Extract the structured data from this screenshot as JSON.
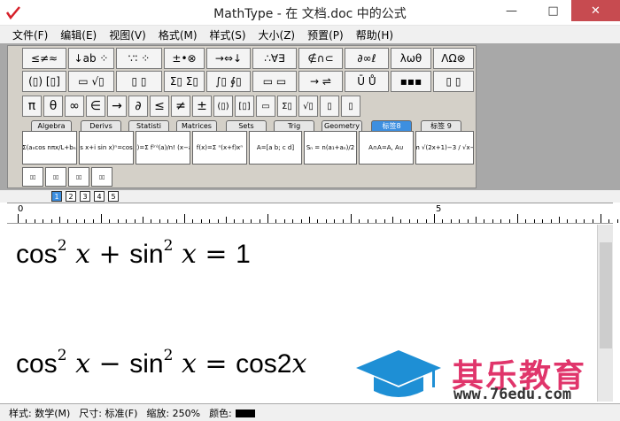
{
  "window": {
    "title": "MathType - 在 文档.doc 中的公式",
    "min": "—",
    "max": "□",
    "close": "✕"
  },
  "menu": [
    "文件(F)",
    "编辑(E)",
    "视图(V)",
    "格式(M)",
    "样式(S)",
    "大小(Z)",
    "预置(P)",
    "帮助(H)"
  ],
  "palette_row1": [
    "≤≠≈",
    "↓ab ⁘",
    "∵∶ ⁘",
    "±•⊗",
    "→⇔↓",
    "∴∀∃",
    "∉∩⊂",
    "∂∞ℓ",
    "λωθ",
    "ΛΩ⊗"
  ],
  "palette_row2": [
    "(▯) [▯]",
    "▭ √▯",
    "▯ ▯",
    "Σ▯ Σ▯",
    "∫▯ ∮▯",
    "▭ ▭",
    "→ ⇌",
    "Ū Ů",
    "▪▪▪",
    "▯ ▯"
  ],
  "symbols": [
    "π",
    "θ",
    "∞",
    "∈",
    "→",
    "∂",
    "≤",
    "≠",
    "±",
    "(▯)",
    "[▯]",
    "▭",
    "Σ▯",
    "√▯",
    "▯",
    "▯"
  ],
  "tabs": [
    "Algebra",
    "Derivs",
    "Statisti",
    "Matrices",
    "Sets",
    "Trig",
    "Geometry",
    "标签8",
    "标签 9"
  ],
  "selected_tab": "标签8",
  "templates": [
    "a(x)=a₀+Σ(aₙcos nπx/L+bₙsin nπx/L)",
    "(cos x+i sin x)ⁿ=cos nx",
    "f(x)=Σ f⁽ⁿ⁾(a)/n! (x−a)ⁿ",
    "f(x)=Σ ⁿ(x+f)xⁿ",
    "A=[a b; c d]",
    "Sₙ = n(a₁+aₙ)/2",
    "A∩A=A, A∪",
    "lim √(2x+1)−3 / √x−2"
  ],
  "nav_buttons": [
    "1",
    "2",
    "3",
    "4",
    "5"
  ],
  "ruler": {
    "start": "0",
    "mid": "5"
  },
  "equations": [
    {
      "fn1": "cos",
      "exp1": "2",
      "var1": "x",
      "op": "+",
      "fn2": "sin",
      "exp2": "2",
      "var2": "x",
      "eq": "=",
      "rhs": "1"
    },
    {
      "fn1": "cos",
      "exp1": "2",
      "var1": "x",
      "op": "−",
      "fn2": "sin",
      "exp2": "2",
      "var2": "x",
      "eq": "=",
      "rhs_fn": "cos",
      "rhs_num": "2",
      "rhs_var": "x"
    }
  ],
  "status": {
    "style": "样式: 数学(M)",
    "size": "尺寸: 标准(F)",
    "zoom": "缩放: 250%",
    "color": "颜色:"
  },
  "watermark": {
    "name": "其乐教育",
    "url": "www.76edu.com"
  }
}
